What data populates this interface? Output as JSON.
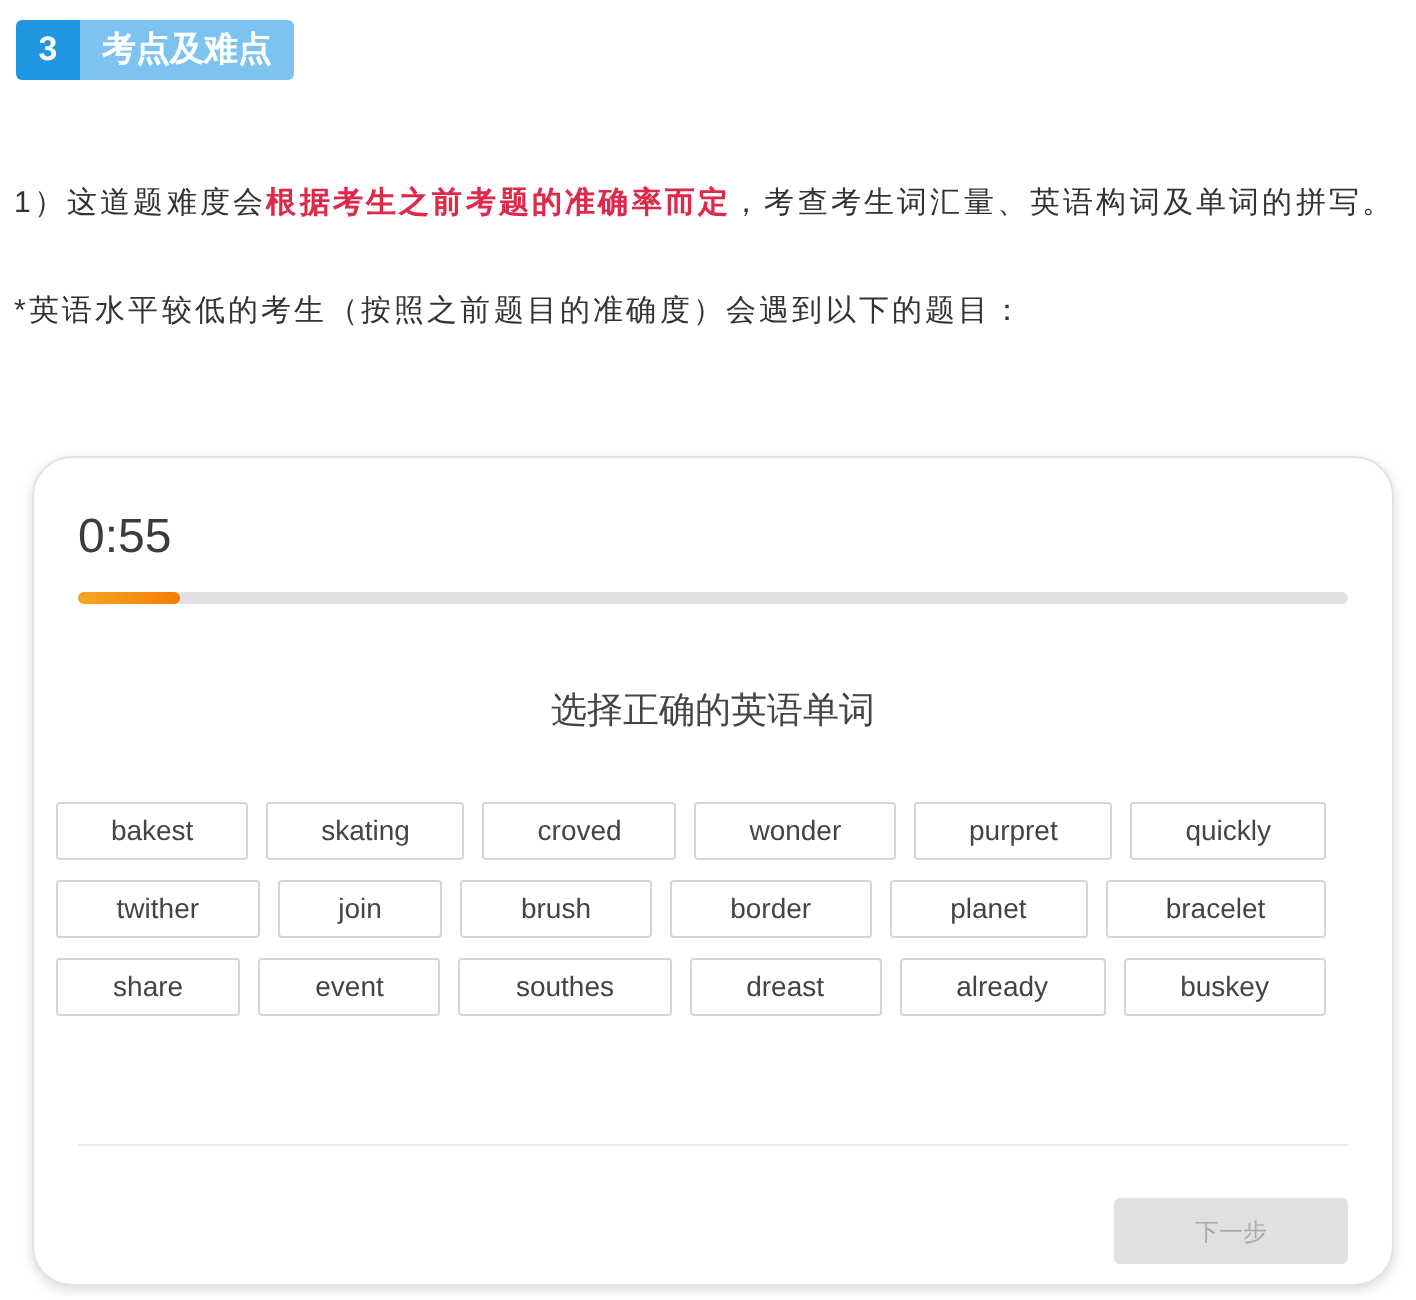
{
  "section": {
    "number": "3",
    "title": "考点及难点"
  },
  "paragraphs": [
    "1）这道题难度会**根据考生之前考题的准确率而定**，考查考生词汇量、英语构词及单词的拼写。",
    "*英语水平较低的考生（按照之前题目的准确度）会遇到以下的题目："
  ],
  "quiz": {
    "timer": "0:55",
    "progress": {
      "level": 0.08
    },
    "prompt": "选择正确的英语单词",
    "word_rows": [
      [
        "bakest",
        "skating",
        "croved",
        "wonder",
        "purpret",
        "quickly"
      ],
      [
        "twither",
        "join",
        "brush",
        "border",
        "planet",
        "bracelet"
      ],
      [
        "share",
        "event",
        "southes",
        "dreast",
        "already",
        "buskey"
      ]
    ],
    "next_button": {
      "label": "下一步",
      "disabled": true
    }
  }
}
